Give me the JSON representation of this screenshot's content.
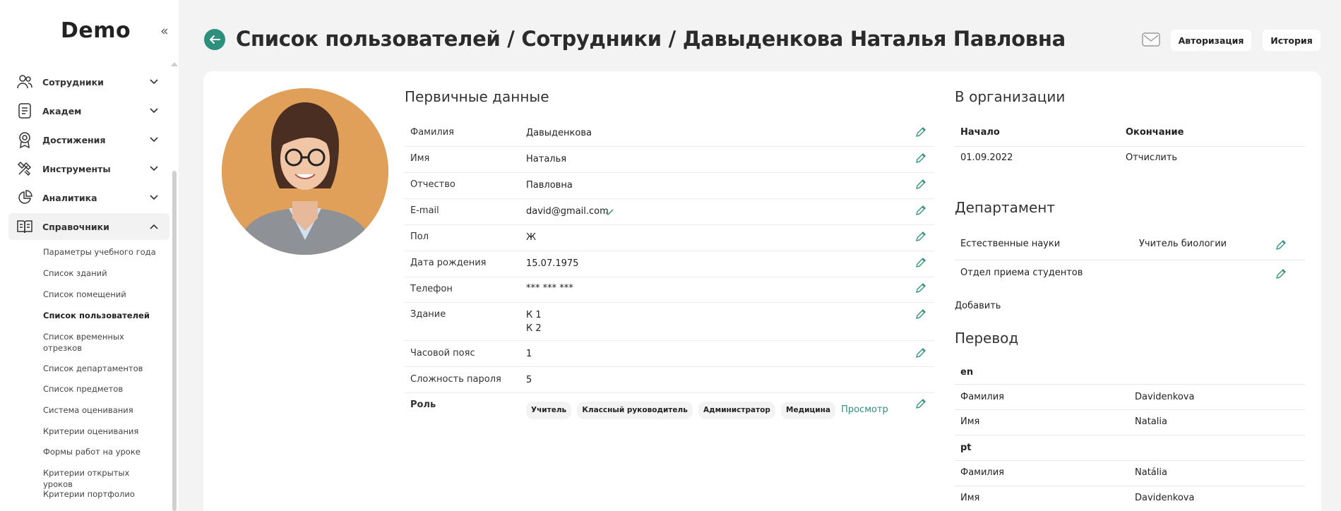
{
  "app": {
    "logo": "Demo"
  },
  "sidebar": {
    "items": [
      {
        "label": "Сотрудники",
        "icon": "users-icon"
      },
      {
        "label": "Академ",
        "icon": "document-icon"
      },
      {
        "label": "Достижения",
        "icon": "award-icon"
      },
      {
        "label": "Инструменты",
        "icon": "tools-icon"
      },
      {
        "label": "Аналитика",
        "icon": "pie-chart-icon"
      },
      {
        "label": "Справочники",
        "icon": "book-icon"
      }
    ],
    "subitems": [
      "Параметры учебного года",
      "Список зданий",
      "Список помещений",
      "Список пользователей",
      "Список временных отрезков",
      "Список департаментов",
      "Список предметов",
      "Система оценивания",
      "Критерии оценивания",
      "Формы работ на уроке",
      "Критерии открытых уроков",
      "Критерии портфолио"
    ]
  },
  "header": {
    "title": "Список пользователей / Сотрудники / Давыденкова Наталья Павловна",
    "auth_label": "Авторизация",
    "history_label": "История"
  },
  "primary": {
    "title": "Первичные данные",
    "fields": [
      {
        "label": "Фамилия",
        "value": "Давыденкова"
      },
      {
        "label": "Имя",
        "value": "Наталья"
      },
      {
        "label": "Отчество",
        "value": "Павловна"
      },
      {
        "label": "E-mail",
        "value": "david@gmail.com"
      },
      {
        "label": "Пол",
        "value": "Ж"
      },
      {
        "label": "Дата рождения",
        "value": "15.07.1975"
      },
      {
        "label": "Телефон",
        "value": "*** *** ***"
      },
      {
        "label": "Здание",
        "value": "К 1",
        "value2": "К 2"
      },
      {
        "label": "Часовой пояс",
        "value": "1"
      },
      {
        "label": "Сложность пароля",
        "value": "5"
      }
    ],
    "role": {
      "label": "Роль",
      "chips": [
        "Учитель",
        "Классный руководитель",
        "Администратор",
        "Медицина"
      ],
      "view_label": "Просмотр"
    }
  },
  "organization": {
    "title": "В организации",
    "start_label": "Начало",
    "end_label": "Окончание",
    "start_value": "01.09.2022",
    "end_value": "Отчислить"
  },
  "department": {
    "title": "Департамент",
    "rows": [
      {
        "name": "Естественные науки",
        "position": "Учитель биологии"
      },
      {
        "name": "Отдел приема студентов",
        "position": ""
      }
    ],
    "add_label": "Добавить"
  },
  "translation": {
    "title": "Перевод",
    "langs": [
      {
        "code": "en",
        "rows": [
          {
            "label": "Фамилия",
            "value": "Davidenkova"
          },
          {
            "label": "Имя",
            "value": "Natalia"
          }
        ]
      },
      {
        "code": "pt",
        "rows": [
          {
            "label": "Фамилия",
            "value": "Natália"
          },
          {
            "label": "Имя",
            "value": "Davidenkova"
          }
        ]
      }
    ]
  },
  "colors": {
    "accent": "#2f8f7d",
    "background": "#f3f3f3"
  }
}
